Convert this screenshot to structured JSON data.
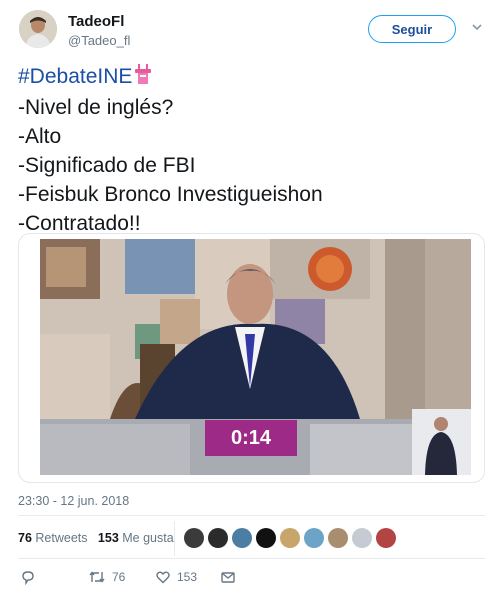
{
  "author": {
    "name": "TadeoFl",
    "handle": "@Tadeo_fl"
  },
  "follow_button": "Seguir",
  "tweet_lines": [
    "#DebateINE",
    "-Nivel de inglés?",
    "-Alto",
    "-Significado de FBI",
    "-Feisbuk Bronco Investigueishon",
    "-Contratado!!"
  ],
  "video": {
    "timer": "0:14"
  },
  "timestamp": "23:30 - 12 jun. 2018",
  "stats": {
    "retweets_count": "76",
    "retweets_label": "Retweets",
    "likes_count": "153",
    "likes_label": "Me gusta"
  },
  "actions": {
    "retweet_count": "76",
    "like_count": "153"
  },
  "colors": {
    "accent": "#1da1f2",
    "link": "#1b4fa5",
    "timer_bg": "#9c2a86"
  }
}
